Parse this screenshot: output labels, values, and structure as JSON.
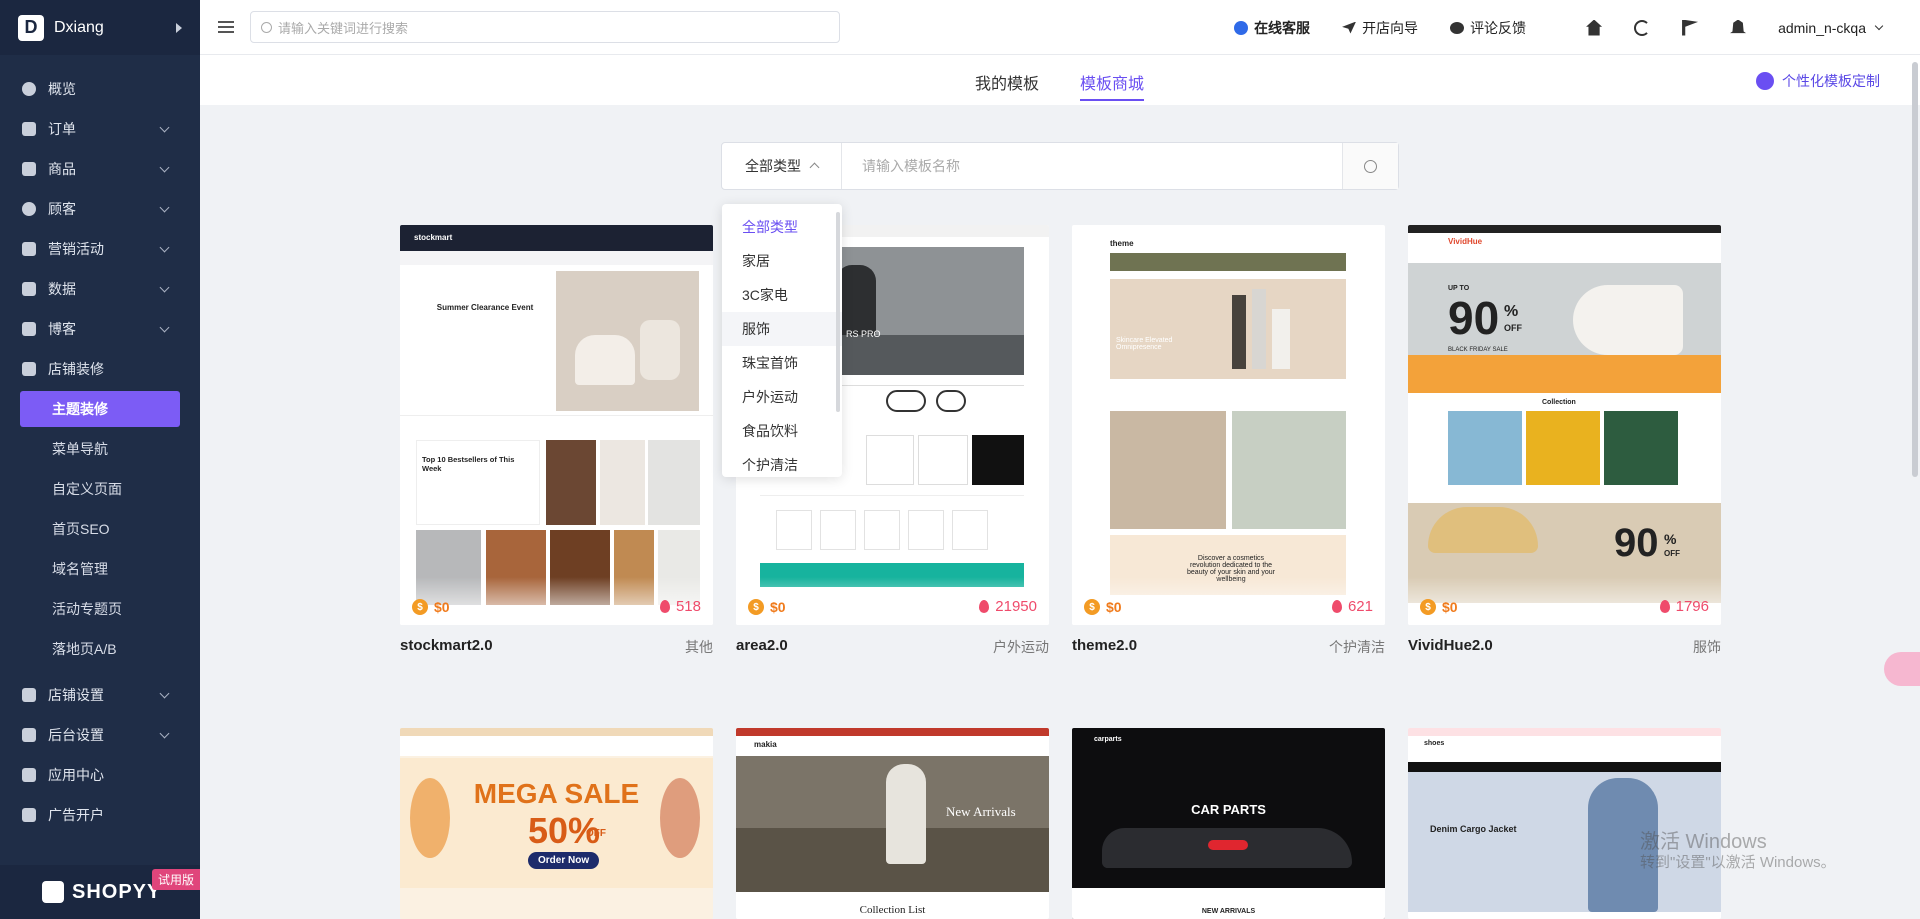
{
  "sidebar": {
    "brand_logo": "D",
    "brand_name": "Dxiang",
    "items": [
      {
        "label": "概览",
        "icon": "dashboard-icon"
      },
      {
        "label": "订单",
        "icon": "order-icon"
      },
      {
        "label": "商品",
        "icon": "product-icon"
      },
      {
        "label": "顾客",
        "icon": "customer-icon"
      },
      {
        "label": "营销活动",
        "icon": "marketing-icon"
      },
      {
        "label": "数据",
        "icon": "data-icon"
      },
      {
        "label": "博客",
        "icon": "blog-icon"
      },
      {
        "label": "店铺装修",
        "icon": "paint-icon"
      }
    ],
    "subitems": [
      "主题装修",
      "菜单导航",
      "自定义页面",
      "首页SEO",
      "域名管理",
      "活动专题页",
      "落地页A/B"
    ],
    "items2": [
      {
        "label": "店铺设置",
        "icon": "store-settings-icon"
      },
      {
        "label": "后台设置",
        "icon": "admin-settings-icon"
      },
      {
        "label": "应用中心",
        "icon": "app-center-icon"
      },
      {
        "label": "广告开户",
        "icon": "ads-icon"
      }
    ],
    "footer_logo": "SHOPYY",
    "trial_badge": "试用版"
  },
  "header": {
    "search_placeholder": "请输入关键词进行搜索",
    "online_service": "在线客服",
    "open_guide": "开店向导",
    "feedback": "评论反馈",
    "user": "admin_n-ckqa"
  },
  "tabs": {
    "my_templates": "我的模板",
    "template_store": "模板商城",
    "custom_link": "个性化模板定制"
  },
  "filter": {
    "type_label": "全部类型",
    "name_placeholder": "请输入模板名称"
  },
  "dropdown": {
    "options": [
      "全部类型",
      "家居",
      "3C家电",
      "服饰",
      "珠宝首饰",
      "户外运动",
      "食品饮料",
      "个护清洁"
    ]
  },
  "templates": [
    {
      "name": "stockmart2.0",
      "category": "其他",
      "price": "$0",
      "likes": "518"
    },
    {
      "name": "area2.0",
      "category": "户外运动",
      "price": "$0",
      "likes": "21950"
    },
    {
      "name": "theme2.0",
      "category": "个护清洁",
      "price": "$0",
      "likes": "621"
    },
    {
      "name": "VividHue2.0",
      "category": "服饰",
      "price": "$0",
      "likes": "1796"
    }
  ],
  "previews": {
    "stockmart": {
      "logo": "stockmart",
      "headline": "Summer Clearance Event",
      "best": "Top 10 Bestsellers of This Week"
    },
    "area": {
      "hero": "RS PRO"
    },
    "theme": {
      "logo": "theme",
      "headline": "Skincare Elevated Omnipresence",
      "sub": "Discover a cosmetics revolution dedicated to the beauty of your skin and your wellbeing"
    },
    "vivid": {
      "logo": "VividHue",
      "big": "90",
      "unit": "%",
      "off": "OFF",
      "upto": "UP TO",
      "sale": "BLACK FRIDAY SALE",
      "collection": "Collection"
    },
    "mega": {
      "line1": "MEGA SALE",
      "line2": "50%",
      "off": "OFF",
      "cta": "Order Now"
    },
    "makia": {
      "logo": "makia",
      "headline": "New Arrivals",
      "footer": "Collection List"
    },
    "car": {
      "logo": "carparts",
      "headline": "CAR PARTS",
      "footer": "NEW ARRIVALS"
    },
    "shoes": {
      "logo": "shoes",
      "headline": "Denim Cargo Jacket"
    }
  },
  "watermark": {
    "line1": "激活 Windows",
    "line2": "转到\"设置\"以激活 Windows。"
  },
  "colors": {
    "sidebar": "#1f2d47",
    "accent": "#7c5cf5",
    "price": "#f07b1c",
    "likes": "#ef4b6b"
  }
}
